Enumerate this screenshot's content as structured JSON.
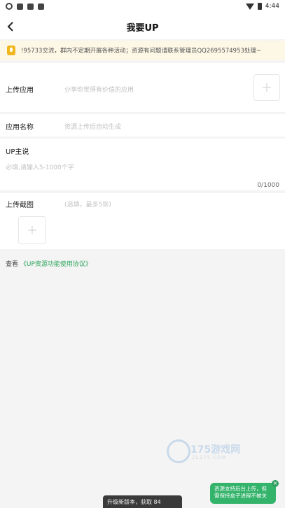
{
  "status": {
    "time": "4:44"
  },
  "header": {
    "title": "我要UP"
  },
  "notice": {
    "text": "!95733交流，群内不定期开展各种活动；资源有问题请联系管理员QQ2695574953处理~"
  },
  "form": {
    "upload_app": {
      "label": "上传应用",
      "placeholder": "分享你觉得有价值的应用"
    },
    "app_name": {
      "label": "应用名称",
      "placeholder": "资源上传后自动生成"
    },
    "up_desc": {
      "label": "UP主说",
      "placeholder": "必填,请输入5-1000个字",
      "counter": "0/1000"
    },
    "screenshots": {
      "label": "上传截图",
      "hint": "(选填，最多5张)"
    }
  },
  "agreement": {
    "prefix": "查看 ",
    "link": "《UP资源功能使用协议》"
  },
  "watermark": {
    "text": "175游戏网",
    "sub": "ZL175.COM"
  },
  "toast": {
    "text": "升级新版本，获取 84"
  },
  "float_tip": {
    "text": "资源支持后台上传，但需保持盒子进程不被关",
    "close": "×"
  },
  "colors": {
    "accent": "#2aa55a",
    "notice_bg": "#fdf7e6",
    "tip_bg": "#34b36b"
  }
}
